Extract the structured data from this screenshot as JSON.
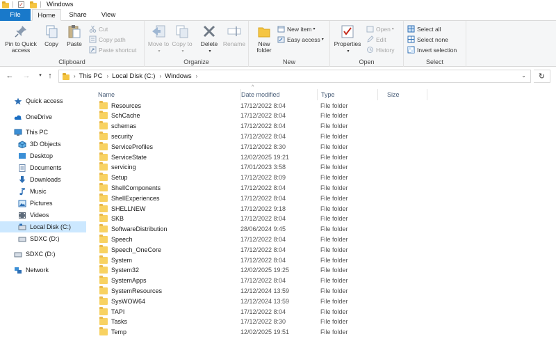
{
  "window": {
    "title": "Windows"
  },
  "ribbon_tabs": [
    "File",
    "Home",
    "Share",
    "View"
  ],
  "ribbon": {
    "clipboard": {
      "label": "Clipboard",
      "pin_label": "Pin to Quick access",
      "copy_label": "Copy",
      "paste_label": "Paste",
      "cut_label": "Cut",
      "copy_path_label": "Copy path",
      "paste_shortcut_label": "Paste shortcut"
    },
    "organize": {
      "label": "Organize",
      "move_to_label": "Move to",
      "copy_to_label": "Copy to",
      "delete_label": "Delete",
      "rename_label": "Rename"
    },
    "new": {
      "label": "New",
      "new_folder_label": "New folder",
      "new_item_label": "New item",
      "easy_access_label": "Easy access"
    },
    "open": {
      "label": "Open",
      "properties_label": "Properties",
      "open_label": "Open",
      "edit_label": "Edit",
      "history_label": "History"
    },
    "select": {
      "label": "Select",
      "select_all_label": "Select all",
      "select_none_label": "Select none",
      "invert_label": "Invert selection"
    }
  },
  "address": {
    "crumbs": [
      "This PC",
      "Local Disk (C:)",
      "Windows"
    ]
  },
  "nav_pane": {
    "quick_access": "Quick access",
    "onedrive": "OneDrive",
    "this_pc": "This PC",
    "objects3d": "3D Objects",
    "desktop": "Desktop",
    "documents": "Documents",
    "downloads": "Downloads",
    "music": "Music",
    "pictures": "Pictures",
    "videos": "Videos",
    "local_disk": "Local Disk (C:)",
    "sdxc_sub": "SDXC (D:)",
    "sdxc": "SDXC (D:)",
    "network": "Network"
  },
  "columns": {
    "name": "Name",
    "date": "Date modified",
    "type": "Type",
    "size": "Size"
  },
  "files": [
    {
      "name": "Resources",
      "date": "17/12/2022 8:04",
      "type": "File folder"
    },
    {
      "name": "SchCache",
      "date": "17/12/2022 8:04",
      "type": "File folder"
    },
    {
      "name": "schemas",
      "date": "17/12/2022 8:04",
      "type": "File folder"
    },
    {
      "name": "security",
      "date": "17/12/2022 8:04",
      "type": "File folder"
    },
    {
      "name": "ServiceProfiles",
      "date": "17/12/2022 8:30",
      "type": "File folder"
    },
    {
      "name": "ServiceState",
      "date": "12/02/2025 19:21",
      "type": "File folder"
    },
    {
      "name": "servicing",
      "date": "17/01/2023 3:58",
      "type": "File folder"
    },
    {
      "name": "Setup",
      "date": "17/12/2022 8:09",
      "type": "File folder"
    },
    {
      "name": "ShellComponents",
      "date": "17/12/2022 8:04",
      "type": "File folder"
    },
    {
      "name": "ShellExperiences",
      "date": "17/12/2022 8:04",
      "type": "File folder"
    },
    {
      "name": "SHELLNEW",
      "date": "17/12/2022 9:18",
      "type": "File folder"
    },
    {
      "name": "SKB",
      "date": "17/12/2022 8:04",
      "type": "File folder"
    },
    {
      "name": "SoftwareDistribution",
      "date": "28/06/2024 9:45",
      "type": "File folder"
    },
    {
      "name": "Speech",
      "date": "17/12/2022 8:04",
      "type": "File folder"
    },
    {
      "name": "Speech_OneCore",
      "date": "17/12/2022 8:04",
      "type": "File folder"
    },
    {
      "name": "System",
      "date": "17/12/2022 8:04",
      "type": "File folder"
    },
    {
      "name": "System32",
      "date": "12/02/2025 19:25",
      "type": "File folder"
    },
    {
      "name": "SystemApps",
      "date": "17/12/2022 8:04",
      "type": "File folder"
    },
    {
      "name": "SystemResources",
      "date": "12/12/2024 13:59",
      "type": "File folder"
    },
    {
      "name": "SysWOW64",
      "date": "12/12/2024 13:59",
      "type": "File folder"
    },
    {
      "name": "TAPI",
      "date": "17/12/2022 8:04",
      "type": "File folder"
    },
    {
      "name": "Tasks",
      "date": "17/12/2022 8:30",
      "type": "File folder"
    },
    {
      "name": "Temp",
      "date": "12/02/2025 19:51",
      "type": "File folder"
    }
  ]
}
